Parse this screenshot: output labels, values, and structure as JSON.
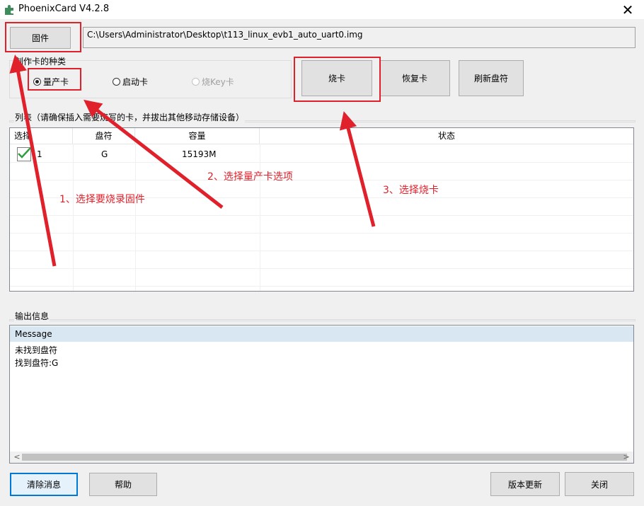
{
  "window": {
    "title": "PhoenixCard V4.2.8",
    "close_glyph": "✕",
    "app_icon": "puzzle-icon"
  },
  "firmware": {
    "button_label": "固件",
    "path": "C:\\Users\\Administrator\\Desktop\\t113_linux_evb1_auto_uart0.img"
  },
  "card_type": {
    "label": "制作卡的种类",
    "options": [
      {
        "label": "量产卡",
        "selected": true
      },
      {
        "label": "启动卡",
        "selected": false
      },
      {
        "label": "烧Key卡",
        "selected": false,
        "disabled": true
      }
    ]
  },
  "actions": {
    "burn": "烧卡",
    "restore": "恢复卡",
    "refresh": "刷新盘符"
  },
  "device_list": {
    "label": "列表（请确保插入需要烧写的卡，并拔出其他移动存储设备）",
    "columns": [
      "选择",
      "盘符",
      "容量",
      "状态"
    ],
    "rows": [
      {
        "checked": true,
        "index": "1",
        "drive": "G",
        "capacity": "15193M",
        "status": ""
      }
    ]
  },
  "output": {
    "label": "输出信息",
    "header": "Message",
    "messages": [
      "未找到盘符",
      "找到盘符:G"
    ]
  },
  "bottom": {
    "clear": "清除消息",
    "help": "帮助",
    "update": "版本更新",
    "close": "关闭"
  },
  "annotations": {
    "step1": "1、选择要烧录固件",
    "step2": "2、选择量产卡选项",
    "step3": "3、选择烧卡"
  },
  "colors": {
    "annotation_red": "#e0212b",
    "focus_blue": "#0078d7",
    "header_blue": "#d9e7f3",
    "check_green": "#2e9e3e"
  }
}
